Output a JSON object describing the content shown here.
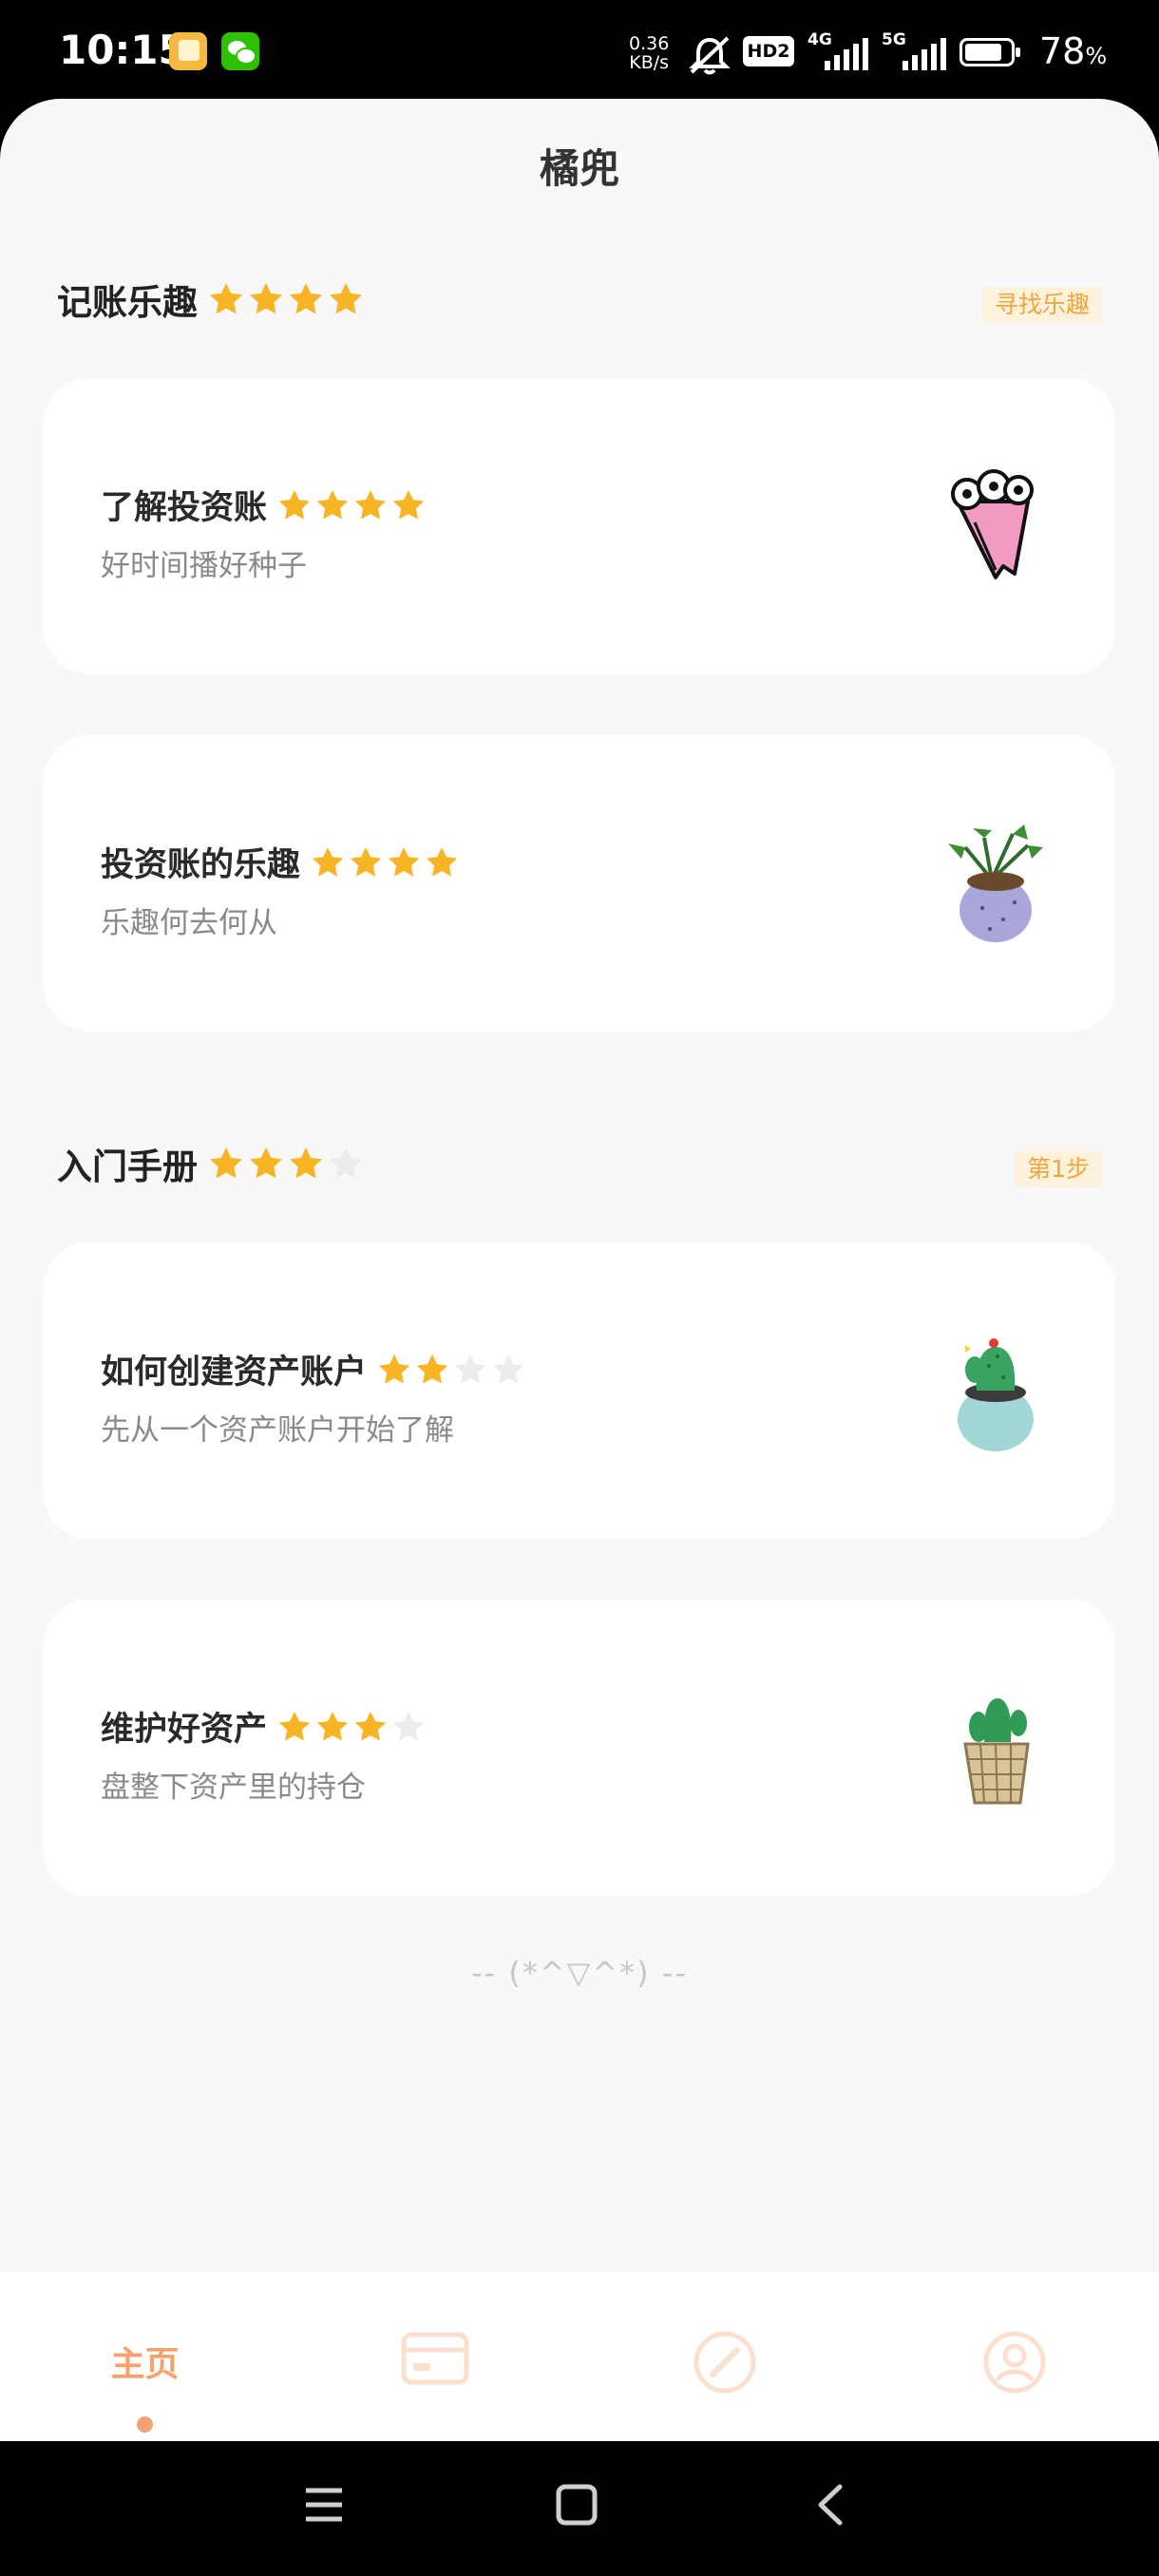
{
  "status_bar": {
    "time": "10:15",
    "net_speed_value": "0.36",
    "net_speed_unit": "KB/s",
    "hd_label": "HD2",
    "signal_1": "4G",
    "signal_2": "5G",
    "battery": "78",
    "battery_unit": "%",
    "battery_level": 0.78,
    "icons": [
      "gallery-app-icon",
      "wechat-icon",
      "mute-icon",
      "signal-icon",
      "battery-icon"
    ]
  },
  "page": {
    "title": "橘兜"
  },
  "sections": [
    {
      "title": "记账乐趣",
      "rating": 4,
      "tag": "寻找乐趣",
      "cards": [
        {
          "title": "了解投资账",
          "rating": 4,
          "subtitle": "好时间播好种子",
          "illustration": "flower-bouquet-icon"
        },
        {
          "title": "投资账的乐趣",
          "rating": 4,
          "subtitle": "乐趣何去何从",
          "illustration": "potted-plant-purple-icon"
        }
      ]
    },
    {
      "title": "入门手册",
      "rating": 3,
      "tag": "第1步",
      "cards": [
        {
          "title": "如何创建资产账户",
          "rating": 2,
          "subtitle": "先从一个资产账户开始了解",
          "illustration": "cactus-teal-pot-icon"
        },
        {
          "title": "维护好资产",
          "rating": 3,
          "subtitle": "盘整下资产里的持仓",
          "illustration": "cactus-basket-icon"
        }
      ]
    }
  ],
  "footer": {
    "text": "-- (*^▽^*) --"
  },
  "tabbar": {
    "active_index": 0,
    "tabs": [
      {
        "label": "主页",
        "icon": "home"
      },
      {
        "label": "",
        "icon": "card-icon"
      },
      {
        "label": "",
        "icon": "compass-icon"
      },
      {
        "label": "",
        "icon": "profile-icon"
      }
    ]
  },
  "navbar": {
    "icons": [
      "menu-icon",
      "home-square-icon",
      "back-icon"
    ]
  },
  "colors": {
    "accent": "#f6a26a",
    "star": "#f7b526",
    "tag_bg": "#fdf2dc",
    "tag_text": "#f0a63a"
  }
}
